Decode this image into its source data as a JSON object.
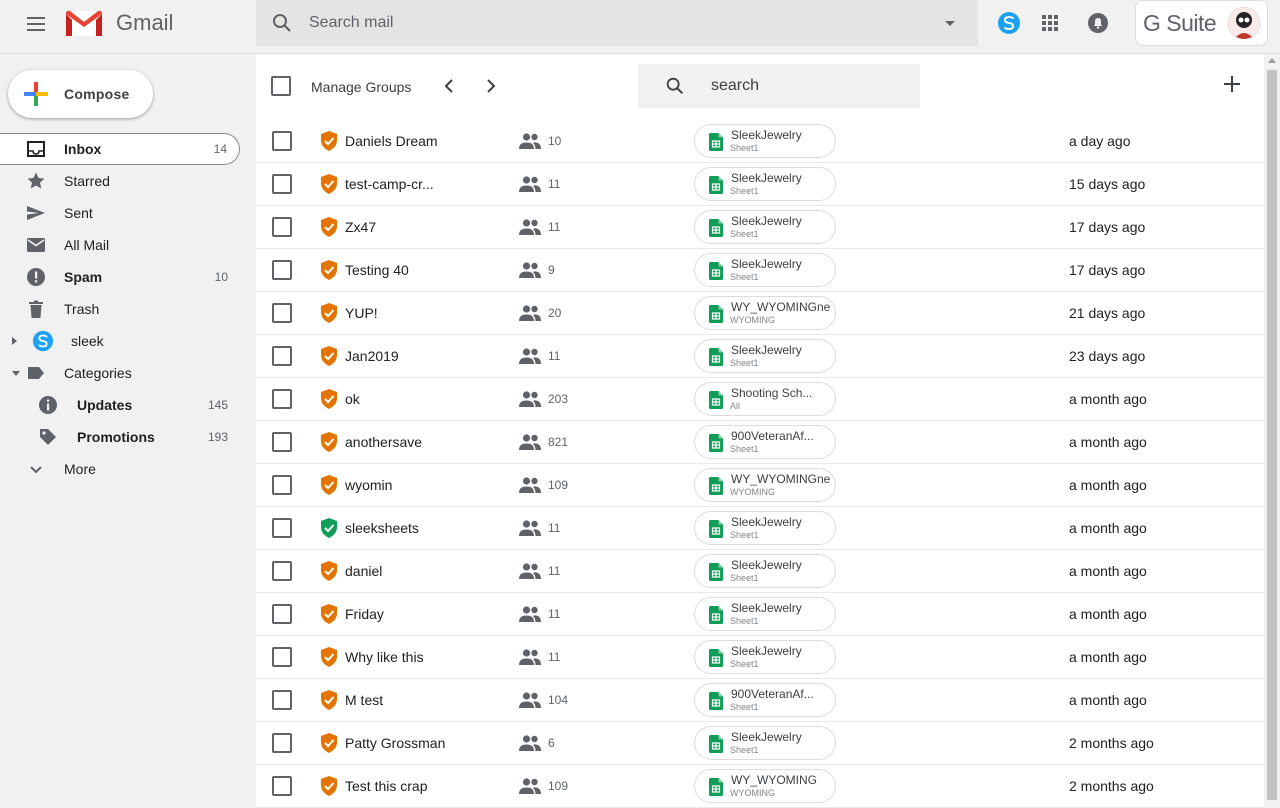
{
  "app": {
    "name": "Gmail",
    "brand": "G Suite"
  },
  "header": {
    "search_placeholder": "Search mail"
  },
  "compose_label": "Compose",
  "nav": [
    {
      "label": "Inbox",
      "count": "14",
      "icon": "inbox-icon",
      "bold": true,
      "active": true
    },
    {
      "label": "Starred",
      "count": "",
      "icon": "star-icon"
    },
    {
      "label": "Sent",
      "count": "",
      "icon": "send-icon"
    },
    {
      "label": "All Mail",
      "count": "",
      "icon": "mail-icon"
    },
    {
      "label": "Spam",
      "count": "10",
      "icon": "spam-icon",
      "bold": true
    },
    {
      "label": "Trash",
      "count": "",
      "icon": "trash-icon"
    },
    {
      "label": "sleek",
      "count": "",
      "icon": "sleek-logo-icon"
    },
    {
      "label": "Categories",
      "count": "",
      "icon": "label-icon"
    },
    {
      "label": "Updates",
      "count": "145",
      "icon": "info-icon",
      "bold": true,
      "sub": true
    },
    {
      "label": "Promotions",
      "count": "193",
      "icon": "tag-icon",
      "bold": true,
      "sub": true
    },
    {
      "label": "More",
      "count": "",
      "icon": "chevron-down-icon"
    }
  ],
  "toolbar": {
    "manage_groups": "Manage Groups",
    "search_placeholder": "search"
  },
  "rows": [
    {
      "name": "Daniels Dream",
      "count": "10",
      "sheet": "SleekJewelry",
      "tab": "Sheet1",
      "time": "a day ago",
      "status": "orange"
    },
    {
      "name": "test-camp-cr...",
      "count": "11",
      "sheet": "SleekJewelry",
      "tab": "Sheet1",
      "time": "15 days ago",
      "status": "orange"
    },
    {
      "name": "Zx47",
      "count": "11",
      "sheet": "SleekJewelry",
      "tab": "Sheet1",
      "time": "17 days ago",
      "status": "orange"
    },
    {
      "name": "Testing 40",
      "count": "9",
      "sheet": "SleekJewelry",
      "tab": "Sheet1",
      "time": "17 days ago",
      "status": "orange"
    },
    {
      "name": "YUP!",
      "count": "20",
      "sheet": "WY_WYOMINGne...",
      "tab": "WYOMING",
      "time": "21 days ago",
      "status": "orange"
    },
    {
      "name": "Jan2019",
      "count": "11",
      "sheet": "SleekJewelry",
      "tab": "Sheet1",
      "time": "23 days ago",
      "status": "orange"
    },
    {
      "name": "ok",
      "count": "203",
      "sheet": "Shooting Sch...",
      "tab": "All",
      "time": "a month ago",
      "status": "orange"
    },
    {
      "name": "anothersave",
      "count": "821",
      "sheet": "900VeteranAf...",
      "tab": "Sheet1",
      "time": "a month ago",
      "status": "orange"
    },
    {
      "name": "wyomin",
      "count": "109",
      "sheet": "WY_WYOMINGne...",
      "tab": "WYOMING",
      "time": "a month ago",
      "status": "orange"
    },
    {
      "name": "sleeksheets",
      "count": "11",
      "sheet": "SleekJewelry",
      "tab": "Sheet1",
      "time": "a month ago",
      "status": "green"
    },
    {
      "name": "daniel",
      "count": "11",
      "sheet": "SleekJewelry",
      "tab": "Sheet1",
      "time": "a month ago",
      "status": "orange"
    },
    {
      "name": "Friday",
      "count": "11",
      "sheet": "SleekJewelry",
      "tab": "Sheet1",
      "time": "a month ago",
      "status": "orange"
    },
    {
      "name": "Why like this",
      "count": "11",
      "sheet": "SleekJewelry",
      "tab": "Sheet1",
      "time": "a month ago",
      "status": "orange"
    },
    {
      "name": "M test",
      "count": "104",
      "sheet": "900VeteranAf...",
      "tab": "Sheet1",
      "time": "a month ago",
      "status": "orange"
    },
    {
      "name": "Patty Grossman",
      "count": "6",
      "sheet": "SleekJewelry",
      "tab": "Sheet1",
      "time": "2 months ago",
      "status": "orange"
    },
    {
      "name": "Test this crap",
      "count": "109",
      "sheet": "WY_WYOMING",
      "tab": "WYOMING",
      "time": "2 months ago",
      "status": "orange"
    }
  ],
  "colors": {
    "orange": "#e37400",
    "green": "#0f9d58",
    "sheets_green": "#0f9d58",
    "sleek_blue": "#1da1f2"
  }
}
